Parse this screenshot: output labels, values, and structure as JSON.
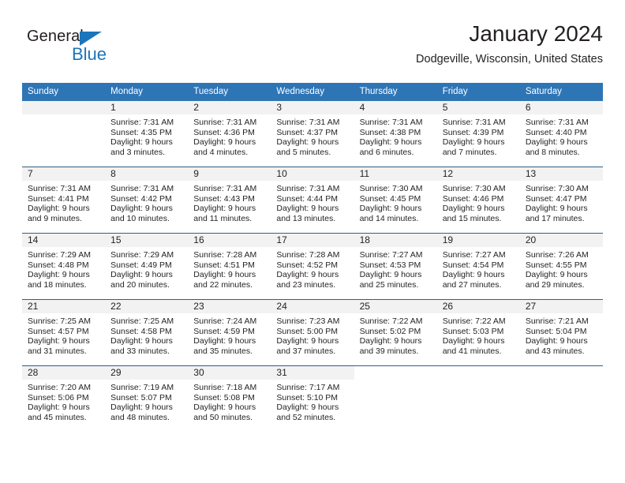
{
  "logo": {
    "word_one": "General",
    "word_two": "Blue",
    "triangle_color": "#1b75bb",
    "text_color": "#231f20"
  },
  "header": {
    "title": "January 2024",
    "subtitle": "Dodgeville, Wisconsin, United States"
  },
  "theme": {
    "header_bg": "#2e75b6",
    "header_text": "#ffffff",
    "daynum_bg": "#f2f2f2",
    "row_divider": "#2e5f8a",
    "body_text": "#231f20"
  },
  "calendar": {
    "weekday_headers": [
      "Sunday",
      "Monday",
      "Tuesday",
      "Wednesday",
      "Thursday",
      "Friday",
      "Saturday"
    ],
    "weeks": [
      [
        {
          "day": "",
          "sunrise": "",
          "sunset": "",
          "daylight_line1": "",
          "daylight_line2": ""
        },
        {
          "day": "1",
          "sunrise": "Sunrise: 7:31 AM",
          "sunset": "Sunset: 4:35 PM",
          "daylight_line1": "Daylight: 9 hours",
          "daylight_line2": "and 3 minutes."
        },
        {
          "day": "2",
          "sunrise": "Sunrise: 7:31 AM",
          "sunset": "Sunset: 4:36 PM",
          "daylight_line1": "Daylight: 9 hours",
          "daylight_line2": "and 4 minutes."
        },
        {
          "day": "3",
          "sunrise": "Sunrise: 7:31 AM",
          "sunset": "Sunset: 4:37 PM",
          "daylight_line1": "Daylight: 9 hours",
          "daylight_line2": "and 5 minutes."
        },
        {
          "day": "4",
          "sunrise": "Sunrise: 7:31 AM",
          "sunset": "Sunset: 4:38 PM",
          "daylight_line1": "Daylight: 9 hours",
          "daylight_line2": "and 6 minutes."
        },
        {
          "day": "5",
          "sunrise": "Sunrise: 7:31 AM",
          "sunset": "Sunset: 4:39 PM",
          "daylight_line1": "Daylight: 9 hours",
          "daylight_line2": "and 7 minutes."
        },
        {
          "day": "6",
          "sunrise": "Sunrise: 7:31 AM",
          "sunset": "Sunset: 4:40 PM",
          "daylight_line1": "Daylight: 9 hours",
          "daylight_line2": "and 8 minutes."
        }
      ],
      [
        {
          "day": "7",
          "sunrise": "Sunrise: 7:31 AM",
          "sunset": "Sunset: 4:41 PM",
          "daylight_line1": "Daylight: 9 hours",
          "daylight_line2": "and 9 minutes."
        },
        {
          "day": "8",
          "sunrise": "Sunrise: 7:31 AM",
          "sunset": "Sunset: 4:42 PM",
          "daylight_line1": "Daylight: 9 hours",
          "daylight_line2": "and 10 minutes."
        },
        {
          "day": "9",
          "sunrise": "Sunrise: 7:31 AM",
          "sunset": "Sunset: 4:43 PM",
          "daylight_line1": "Daylight: 9 hours",
          "daylight_line2": "and 11 minutes."
        },
        {
          "day": "10",
          "sunrise": "Sunrise: 7:31 AM",
          "sunset": "Sunset: 4:44 PM",
          "daylight_line1": "Daylight: 9 hours",
          "daylight_line2": "and 13 minutes."
        },
        {
          "day": "11",
          "sunrise": "Sunrise: 7:30 AM",
          "sunset": "Sunset: 4:45 PM",
          "daylight_line1": "Daylight: 9 hours",
          "daylight_line2": "and 14 minutes."
        },
        {
          "day": "12",
          "sunrise": "Sunrise: 7:30 AM",
          "sunset": "Sunset: 4:46 PM",
          "daylight_line1": "Daylight: 9 hours",
          "daylight_line2": "and 15 minutes."
        },
        {
          "day": "13",
          "sunrise": "Sunrise: 7:30 AM",
          "sunset": "Sunset: 4:47 PM",
          "daylight_line1": "Daylight: 9 hours",
          "daylight_line2": "and 17 minutes."
        }
      ],
      [
        {
          "day": "14",
          "sunrise": "Sunrise: 7:29 AM",
          "sunset": "Sunset: 4:48 PM",
          "daylight_line1": "Daylight: 9 hours",
          "daylight_line2": "and 18 minutes."
        },
        {
          "day": "15",
          "sunrise": "Sunrise: 7:29 AM",
          "sunset": "Sunset: 4:49 PM",
          "daylight_line1": "Daylight: 9 hours",
          "daylight_line2": "and 20 minutes."
        },
        {
          "day": "16",
          "sunrise": "Sunrise: 7:28 AM",
          "sunset": "Sunset: 4:51 PM",
          "daylight_line1": "Daylight: 9 hours",
          "daylight_line2": "and 22 minutes."
        },
        {
          "day": "17",
          "sunrise": "Sunrise: 7:28 AM",
          "sunset": "Sunset: 4:52 PM",
          "daylight_line1": "Daylight: 9 hours",
          "daylight_line2": "and 23 minutes."
        },
        {
          "day": "18",
          "sunrise": "Sunrise: 7:27 AM",
          "sunset": "Sunset: 4:53 PM",
          "daylight_line1": "Daylight: 9 hours",
          "daylight_line2": "and 25 minutes."
        },
        {
          "day": "19",
          "sunrise": "Sunrise: 7:27 AM",
          "sunset": "Sunset: 4:54 PM",
          "daylight_line1": "Daylight: 9 hours",
          "daylight_line2": "and 27 minutes."
        },
        {
          "day": "20",
          "sunrise": "Sunrise: 7:26 AM",
          "sunset": "Sunset: 4:55 PM",
          "daylight_line1": "Daylight: 9 hours",
          "daylight_line2": "and 29 minutes."
        }
      ],
      [
        {
          "day": "21",
          "sunrise": "Sunrise: 7:25 AM",
          "sunset": "Sunset: 4:57 PM",
          "daylight_line1": "Daylight: 9 hours",
          "daylight_line2": "and 31 minutes."
        },
        {
          "day": "22",
          "sunrise": "Sunrise: 7:25 AM",
          "sunset": "Sunset: 4:58 PM",
          "daylight_line1": "Daylight: 9 hours",
          "daylight_line2": "and 33 minutes."
        },
        {
          "day": "23",
          "sunrise": "Sunrise: 7:24 AM",
          "sunset": "Sunset: 4:59 PM",
          "daylight_line1": "Daylight: 9 hours",
          "daylight_line2": "and 35 minutes."
        },
        {
          "day": "24",
          "sunrise": "Sunrise: 7:23 AM",
          "sunset": "Sunset: 5:00 PM",
          "daylight_line1": "Daylight: 9 hours",
          "daylight_line2": "and 37 minutes."
        },
        {
          "day": "25",
          "sunrise": "Sunrise: 7:22 AM",
          "sunset": "Sunset: 5:02 PM",
          "daylight_line1": "Daylight: 9 hours",
          "daylight_line2": "and 39 minutes."
        },
        {
          "day": "26",
          "sunrise": "Sunrise: 7:22 AM",
          "sunset": "Sunset: 5:03 PM",
          "daylight_line1": "Daylight: 9 hours",
          "daylight_line2": "and 41 minutes."
        },
        {
          "day": "27",
          "sunrise": "Sunrise: 7:21 AM",
          "sunset": "Sunset: 5:04 PM",
          "daylight_line1": "Daylight: 9 hours",
          "daylight_line2": "and 43 minutes."
        }
      ],
      [
        {
          "day": "28",
          "sunrise": "Sunrise: 7:20 AM",
          "sunset": "Sunset: 5:06 PM",
          "daylight_line1": "Daylight: 9 hours",
          "daylight_line2": "and 45 minutes."
        },
        {
          "day": "29",
          "sunrise": "Sunrise: 7:19 AM",
          "sunset": "Sunset: 5:07 PM",
          "daylight_line1": "Daylight: 9 hours",
          "daylight_line2": "and 48 minutes."
        },
        {
          "day": "30",
          "sunrise": "Sunrise: 7:18 AM",
          "sunset": "Sunset: 5:08 PM",
          "daylight_line1": "Daylight: 9 hours",
          "daylight_line2": "and 50 minutes."
        },
        {
          "day": "31",
          "sunrise": "Sunrise: 7:17 AM",
          "sunset": "Sunset: 5:10 PM",
          "daylight_line1": "Daylight: 9 hours",
          "daylight_line2": "and 52 minutes."
        },
        {
          "day": "",
          "sunrise": "",
          "sunset": "",
          "daylight_line1": "",
          "daylight_line2": ""
        },
        {
          "day": "",
          "sunrise": "",
          "sunset": "",
          "daylight_line1": "",
          "daylight_line2": ""
        },
        {
          "day": "",
          "sunrise": "",
          "sunset": "",
          "daylight_line1": "",
          "daylight_line2": ""
        }
      ]
    ]
  }
}
